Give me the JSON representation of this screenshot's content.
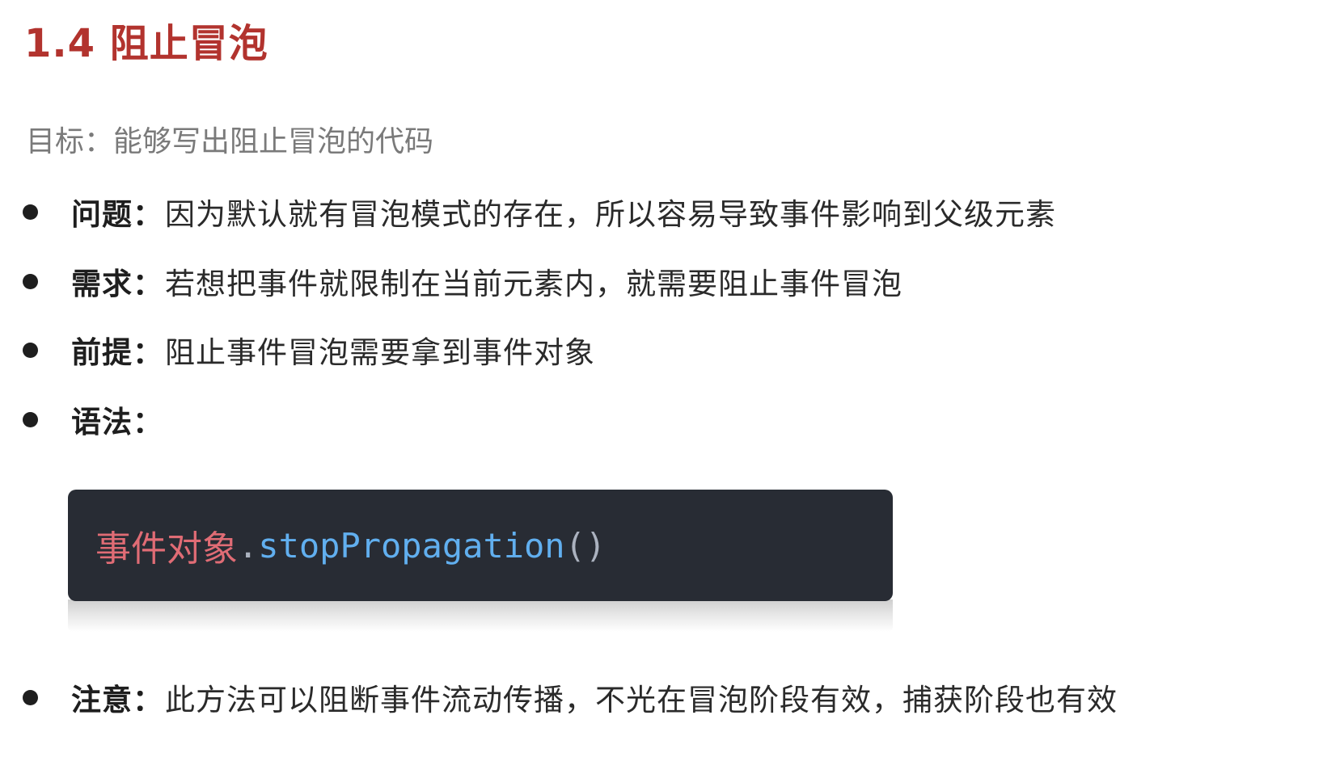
{
  "heading": {
    "title": "1.4 阻止冒泡"
  },
  "goal": {
    "text": "目标：能够写出阻止冒泡的代码"
  },
  "bullets": [
    {
      "label": "问题：",
      "text": "因为默认就有冒泡模式的存在，所以容易导致事件影响到父级元素"
    },
    {
      "label": "需求：",
      "text": "若想把事件就限制在当前元素内，就需要阻止事件冒泡"
    },
    {
      "label": "前提：",
      "text": "阻止事件冒泡需要拿到事件对象"
    },
    {
      "label": "语法：",
      "text": ""
    },
    {
      "label": "注意：",
      "text": "此方法可以阻断事件流动传播，不光在冒泡阶段有效，捕获阶段也有效"
    }
  ],
  "code": {
    "object": "事件对象",
    "dot": ".",
    "method": "stopPropagation",
    "parens": "()"
  },
  "colors": {
    "title": "#b2332e",
    "code_background": "#282c34",
    "code_object": "#e06c75",
    "code_method": "#61afef",
    "code_punctuation": "#abb2bf"
  }
}
